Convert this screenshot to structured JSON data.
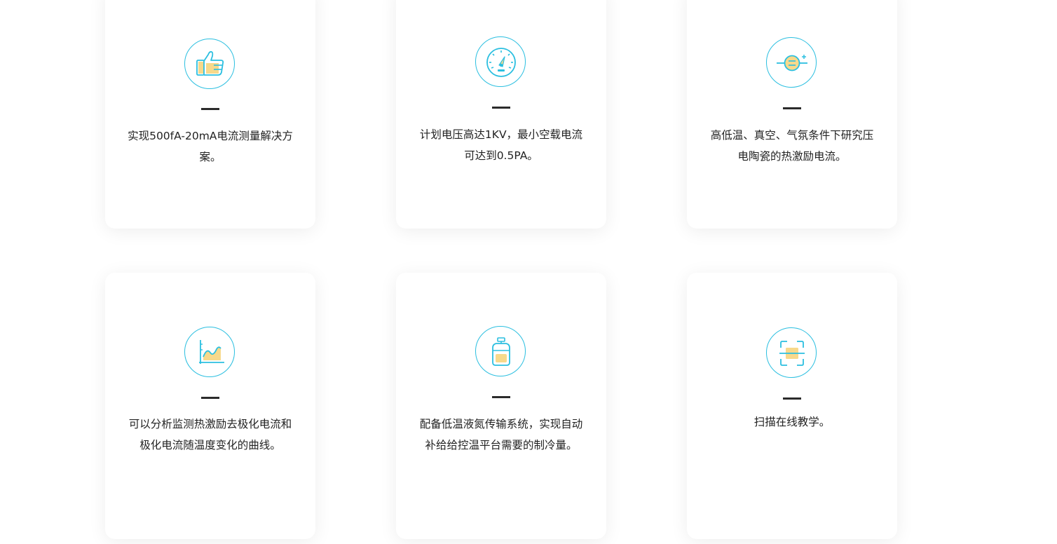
{
  "features": [
    {
      "icon": "thumbs-up-icon",
      "text": "实现500fA-20mA电流测量解决方案。"
    },
    {
      "icon": "pressure-gauge-icon",
      "text": "计划电压高达1KV，最小空载电流可达到0.5PA。"
    },
    {
      "icon": "capacitor-icon",
      "text": "高低温、真空、气氛条件下研究压电陶瓷的热激励电流。"
    },
    {
      "icon": "line-chart-icon",
      "text": "可以分析监测热激励去极化电流和极化电流随温度变化的曲线。"
    },
    {
      "icon": "liquid-nitrogen-tank-icon",
      "text": "配备低温液氮传输系统，实现自动补给给控温平台需要的制冷量。"
    },
    {
      "icon": "scan-icon",
      "text": "扫描在线教学。"
    }
  ],
  "colors": {
    "accent": "#2bbfe0",
    "icon_fill": "#f7d98b",
    "text": "#222222",
    "dash": "#2b2b2b"
  }
}
